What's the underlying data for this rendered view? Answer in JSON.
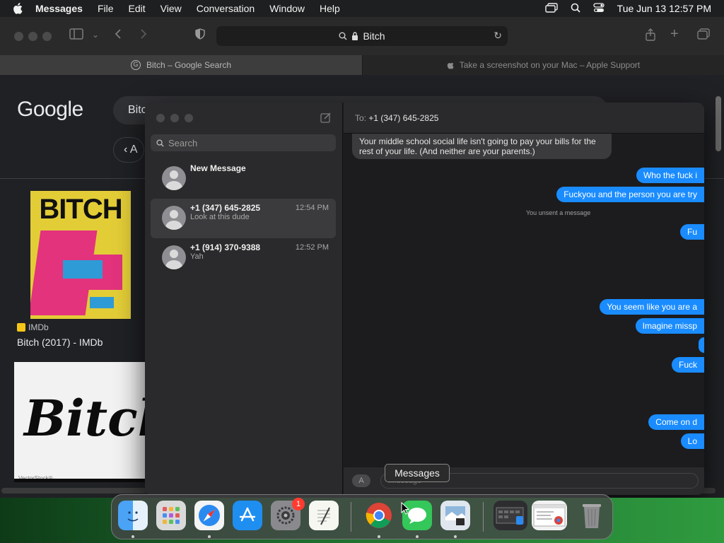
{
  "menubar": {
    "app": "Messages",
    "items": [
      "File",
      "Edit",
      "View",
      "Conversation",
      "Window",
      "Help"
    ],
    "clock": "Tue Jun 13  12:57 PM"
  },
  "safari": {
    "address": "Bitch",
    "tabs": [
      {
        "label": "Bitch – Google Search"
      },
      {
        "label": "Take a screenshot on your Mac – Apple Support"
      }
    ]
  },
  "google": {
    "logo": "Google",
    "query": "Bitc",
    "back_label": "A",
    "result": {
      "poster_title": "BITCH",
      "source": "IMDb",
      "title": "Bitch (2017) - IMDb"
    },
    "image2": {
      "graffiti": "Bitch",
      "watermark": "VectorStock®"
    }
  },
  "messages": {
    "search_placeholder": "Search",
    "conversations": [
      {
        "name": "New Message",
        "preview": "",
        "time": ""
      },
      {
        "name": "+1 (347) 645-2825",
        "preview": "Look at this dude",
        "time": "12:54 PM"
      },
      {
        "name": "+1 (914) 370-9388",
        "preview": "Yah",
        "time": "12:52 PM"
      }
    ],
    "header": {
      "to_label": "To:",
      "recipient": "+1 (347) 645-2825"
    },
    "thread": [
      {
        "dir": "in",
        "text": "Your middle school social life isn't going to pay your bills for the rest of your life.  (And neither are your parents.)"
      },
      {
        "dir": "out",
        "text": "Who the fuck i"
      },
      {
        "dir": "out",
        "text": "Fuckyou and the person you are try"
      },
      {
        "dir": "system",
        "text": "You unsent a message"
      },
      {
        "dir": "out",
        "text": "Fu"
      },
      {
        "dir": "out",
        "text": "You seem like you are a"
      },
      {
        "dir": "out",
        "text": "Imagine missp"
      },
      {
        "dir": "out",
        "text": ""
      },
      {
        "dir": "out",
        "text": "Fuck"
      },
      {
        "dir": "out",
        "text": "Come on d"
      },
      {
        "dir": "out",
        "text": "Lo"
      }
    ],
    "input_placeholder": "iMessage"
  },
  "tooltip": "Messages",
  "dock": {
    "items": [
      {
        "name": "finder"
      },
      {
        "name": "launchpad"
      },
      {
        "name": "safari"
      },
      {
        "name": "app-store"
      },
      {
        "name": "system-settings",
        "badge": "1"
      },
      {
        "name": "textedit"
      },
      {
        "name": "chrome"
      },
      {
        "name": "messages"
      },
      {
        "name": "preview"
      },
      {
        "name": "screenshot-stack"
      },
      {
        "name": "chrome-window"
      },
      {
        "name": "trash"
      }
    ]
  }
}
